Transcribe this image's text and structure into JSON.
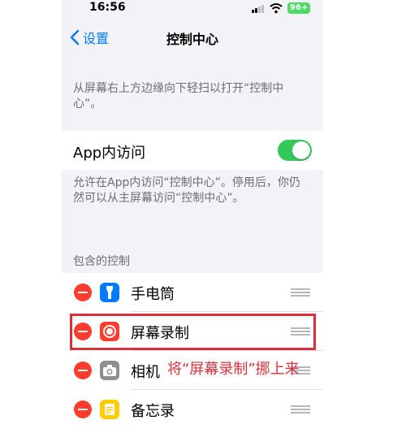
{
  "status_bar": {
    "time": "16:56",
    "battery": "96+"
  },
  "nav": {
    "back_label": "设置",
    "title": "控制中心"
  },
  "intro_text": "从屏幕右上方边缘向下轻扫以打开“控制中心”。",
  "app_access": {
    "label": "App内访问",
    "enabled": true,
    "description": "允许在App内访问“控制中心”。停用后，你仍然可以从主屏幕访问“控制中心”。"
  },
  "included_controls": {
    "header": "包含的控制",
    "items": [
      {
        "label": "手电筒",
        "icon": "flashlight-icon",
        "icon_color": "#007aff"
      },
      {
        "label": "屏幕录制",
        "icon": "screen-record-icon",
        "icon_color": "#ff3b30"
      },
      {
        "label": "相机",
        "icon": "camera-icon",
        "icon_color": "#8e8e93"
      },
      {
        "label": "备忘录",
        "icon": "notes-icon",
        "icon_color": "#ffcc00"
      }
    ]
  },
  "annotation": {
    "text": "将“屏幕录制”挪上来",
    "color": "#d9303e"
  },
  "colors": {
    "accent": "#007aff",
    "toggle_on": "#34c759",
    "delete": "#ff3b30"
  }
}
